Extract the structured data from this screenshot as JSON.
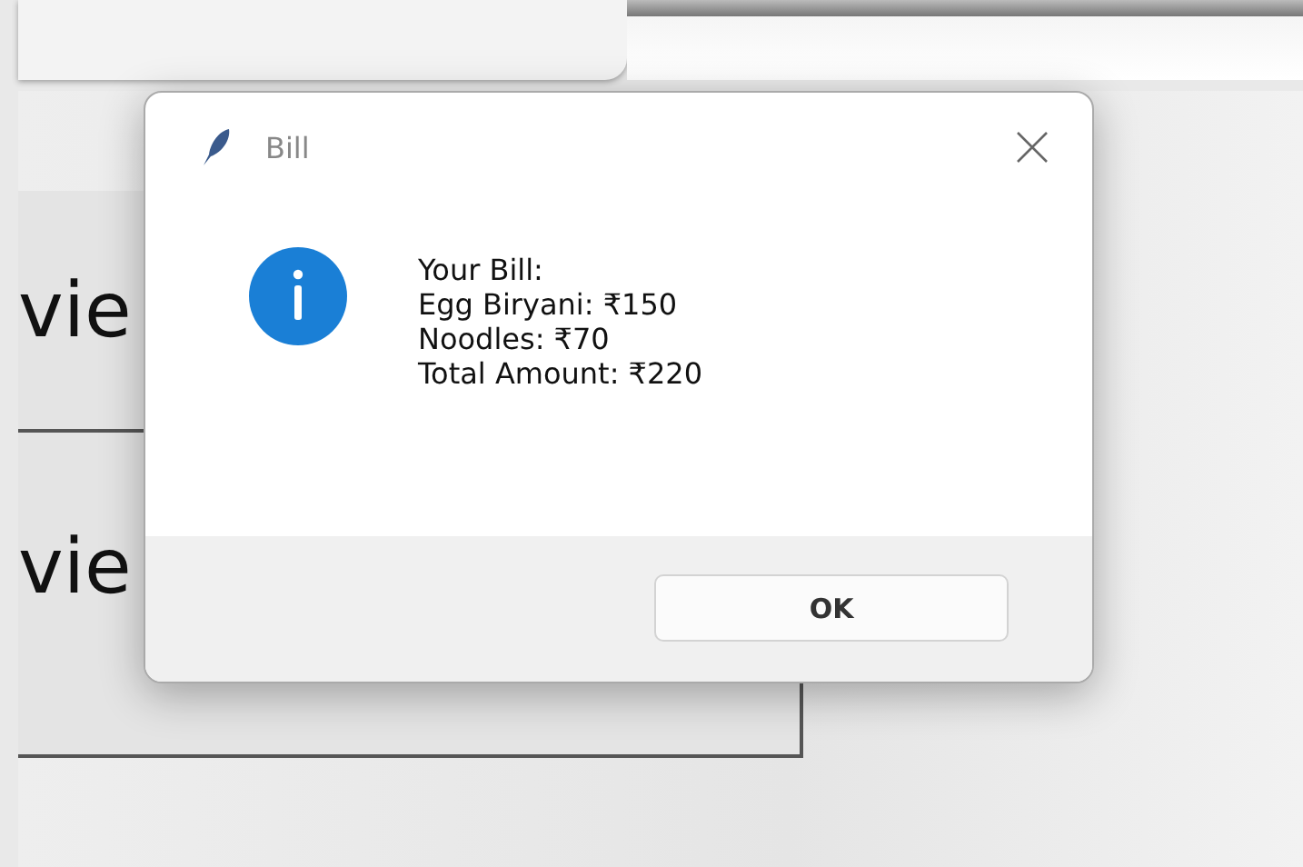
{
  "background_window": {
    "buttons": [
      "vie",
      "vie"
    ]
  },
  "dialog": {
    "title": "Bill",
    "message": "Your Bill:\nEgg Biryani: ₹150\nNoodles: ₹70\nTotal Amount: ₹220",
    "ok_button": "OK"
  }
}
